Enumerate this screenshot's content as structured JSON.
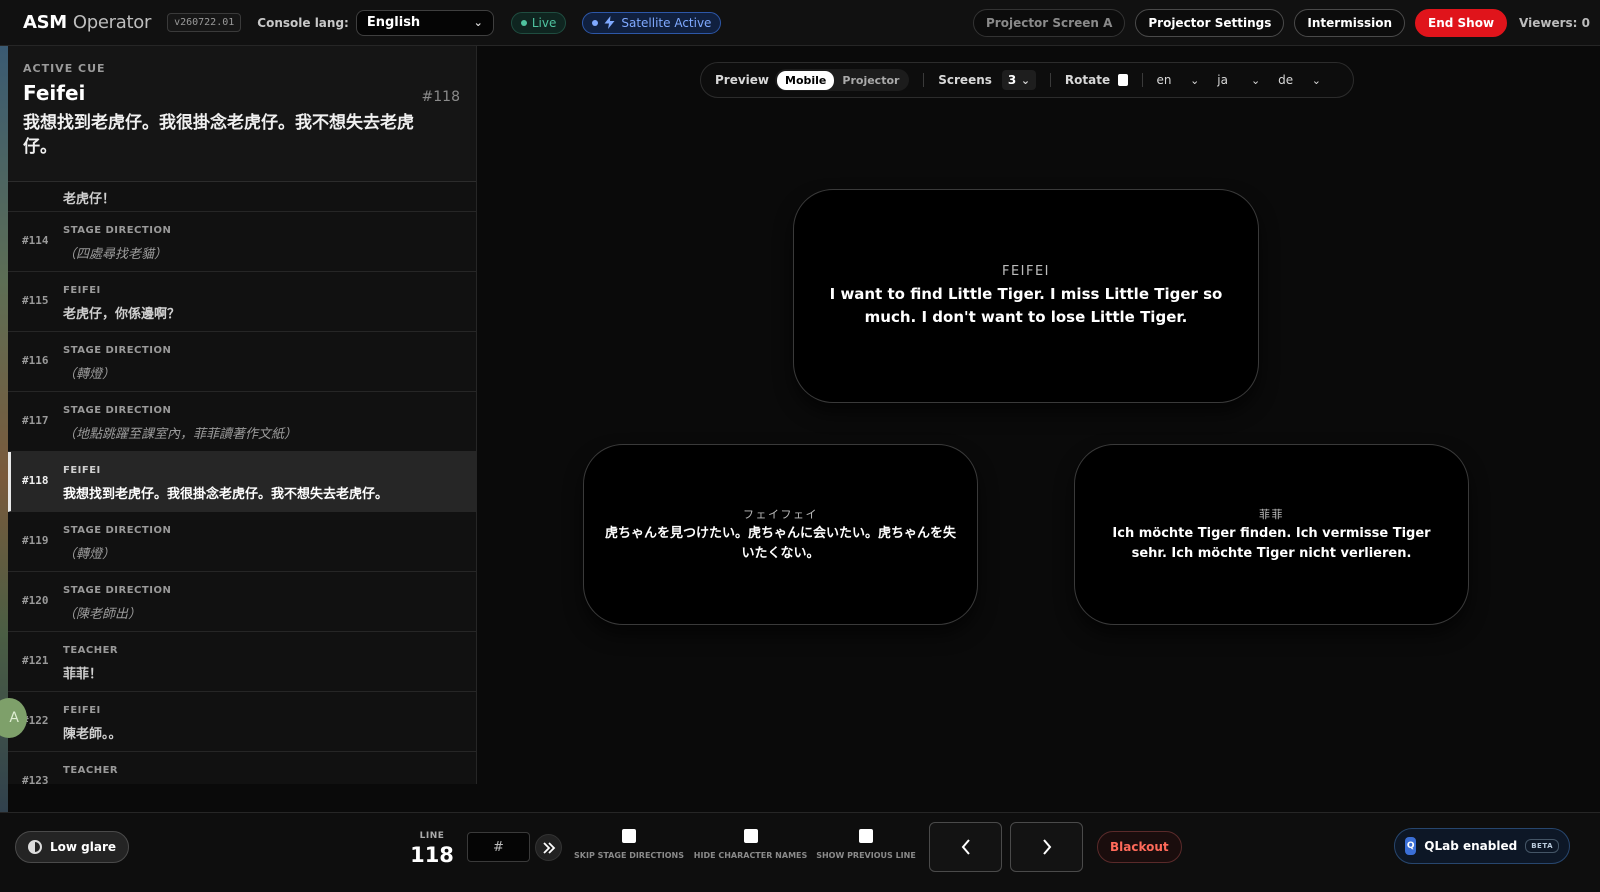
{
  "header": {
    "brand_main": "ASM",
    "brand_sub": "Operator",
    "version": "v260722.01",
    "console_lang_label": "Console lang:",
    "console_lang_value": "English",
    "live_label": "Live",
    "satellite_label": "Satellite Active",
    "projector_screen": "Projector Screen A",
    "projector_settings": "Projector Settings",
    "intermission": "Intermission",
    "end_show": "End Show",
    "viewers": "Viewers: 0"
  },
  "active_cue": {
    "label": "ACTIVE CUE",
    "character": "Feifei",
    "number": "#118",
    "text": "我想找到老虎仔。我很掛念老虎仔。我不想失去老虎仔。"
  },
  "cues": [
    {
      "num": "",
      "speaker": "",
      "text": "老虎仔！",
      "type": "dialogue",
      "partial": true
    },
    {
      "num": "#114",
      "speaker": "STAGE DIRECTION",
      "text": "（四處尋找老貓）",
      "type": "direction"
    },
    {
      "num": "#115",
      "speaker": "FEIFEI",
      "text": "老虎仔，你係邊啊？",
      "type": "dialogue"
    },
    {
      "num": "#116",
      "speaker": "STAGE DIRECTION",
      "text": "（轉燈）",
      "type": "direction"
    },
    {
      "num": "#117",
      "speaker": "STAGE DIRECTION",
      "text": "（地點跳躍至課室內，菲菲讀著作文紙）",
      "type": "direction"
    },
    {
      "num": "#118",
      "speaker": "FEIFEI",
      "text": "我想找到老虎仔。我很掛念老虎仔。我不想失去老虎仔。",
      "type": "dialogue",
      "active": true
    },
    {
      "num": "#119",
      "speaker": "STAGE DIRECTION",
      "text": "（轉燈）",
      "type": "direction"
    },
    {
      "num": "#120",
      "speaker": "STAGE DIRECTION",
      "text": "（陳老師出）",
      "type": "direction"
    },
    {
      "num": "#121",
      "speaker": "TEACHER",
      "text": "菲菲！",
      "type": "dialogue"
    },
    {
      "num": "#122",
      "speaker": "FEIFEI",
      "text": "陳老師。。",
      "type": "dialogue"
    },
    {
      "num": "#123",
      "speaker": "TEACHER",
      "text": "",
      "type": "dialogue"
    }
  ],
  "avatar_initial": "A",
  "preview_bar": {
    "preview_label": "Preview",
    "mode_mobile": "Mobile",
    "mode_projector": "Projector",
    "screens_label": "Screens",
    "screens_value": "3",
    "rotate_label": "Rotate",
    "lang1": "en",
    "lang2": "ja",
    "lang3": "de"
  },
  "screens": {
    "en": {
      "name": "FEIFEI",
      "text": "I want to find Little Tiger. I miss Little Tiger so much. I don't want to lose Little Tiger."
    },
    "ja": {
      "name": "フェイフェイ",
      "text": "虎ちゃんを見つけたい。虎ちゃんに会いたい。虎ちゃんを失いたくない。"
    },
    "de": {
      "name": "菲菲",
      "text": "Ich möchte Tiger finden. Ich vermisse Tiger sehr. Ich möchte Tiger nicht verlieren."
    }
  },
  "bottom": {
    "low_glare": "Low glare",
    "line_label": "LINE",
    "line_number": "118",
    "line_input_placeholder": "#",
    "skip_stage": "SKIP STAGE DIRECTIONS",
    "hide_names": "HIDE CHARACTER NAMES",
    "show_prev": "SHOW PREVIOUS LINE",
    "blackout": "Blackout",
    "qlab_label": "QLab enabled",
    "qlab_badge": "BETA",
    "qlab_icon_letter": "Q"
  },
  "icons": {
    "jump": "double-chevron-right-icon",
    "prev": "chevron-left-icon",
    "next": "chevron-right-icon",
    "satellite": "lightning-icon"
  },
  "colors": {
    "end_show": "#e0141b",
    "live": "#4fc4a0",
    "satellite": "#7fa9ff",
    "blackout": "#ff6a5a"
  }
}
